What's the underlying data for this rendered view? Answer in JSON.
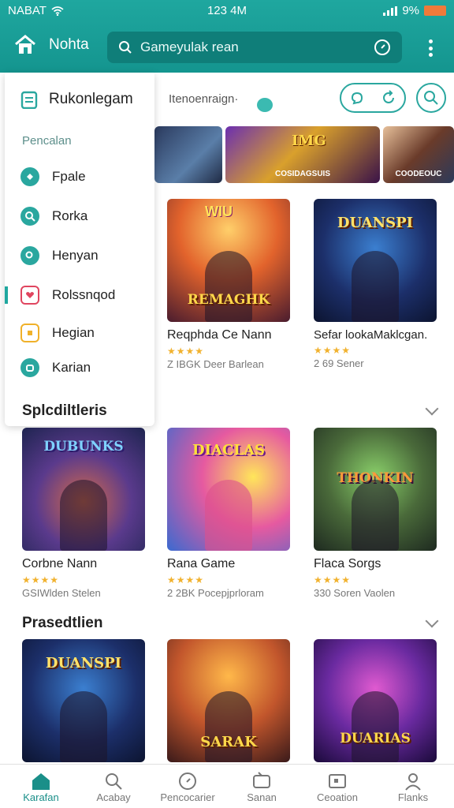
{
  "status": {
    "carrier": "NABAT",
    "time": "123 4M",
    "battery": "9%"
  },
  "appbar": {
    "home_label": "Nohta",
    "search_placeholder": "Gameyulak rean"
  },
  "subbar": {
    "label": "Itenoenraign·"
  },
  "banners": [
    {
      "caption": ""
    },
    {
      "caption": "COSIDAGSUIS",
      "logo": "IMG"
    },
    {
      "caption": ""
    },
    {
      "caption": "COODEOUC"
    }
  ],
  "featured": [
    {
      "title": "Reqphda Ce Nann",
      "stars": "★★★★",
      "meta": "Z IBGK Deer Barlean",
      "logo": "REMAGHK",
      "badge": "WIU"
    },
    {
      "title": "Sefar lookaMaklcgan.",
      "stars": "★★★★",
      "meta": "2 69 Sener",
      "logo": "DUANSPI"
    }
  ],
  "drawer": {
    "title": "Rukonlegam",
    "section": "Pencalan",
    "items": [
      {
        "label": "Fpale",
        "color": "#2aa79f"
      },
      {
        "label": "Rorka",
        "color": "#2aa79f"
      },
      {
        "label": "Henyan",
        "color": "#2aa79f"
      },
      {
        "label": "Rolssnqod",
        "color": "#e0455f",
        "active": true
      },
      {
        "label": "Hegian",
        "color": "#f0b12a"
      },
      {
        "label": "Karian",
        "color": "#2aa79f"
      }
    ]
  },
  "sections": [
    {
      "title": "Splcdiltleris",
      "cards": [
        {
          "title": "Corbne Nann",
          "stars": "★★★★",
          "meta": "GSIWlden Stelen",
          "logo": "DUBUNKS"
        },
        {
          "title": "Rana Game",
          "stars": "★★★★",
          "meta": "2 2BK Pocepjprloram",
          "logo": "DIACLAS"
        },
        {
          "title": "Flaca Sorgs",
          "stars": "★★★★",
          "meta": "330 Soren Vaolen",
          "logo": "THONKIN"
        }
      ]
    },
    {
      "title": "Prasedtlien",
      "cards": [
        {
          "logo": "DUANSPI"
        },
        {
          "logo": "SARAK"
        },
        {
          "logo": "DUARIAS"
        }
      ]
    }
  ],
  "bottomnav": [
    {
      "label": "Karafan",
      "icon": "home-icon",
      "active": true
    },
    {
      "label": "Acabay",
      "icon": "search-icon"
    },
    {
      "label": "Pencocarier",
      "icon": "compass-icon"
    },
    {
      "label": "Sanan",
      "icon": "controller-icon"
    },
    {
      "label": "Ceoation",
      "icon": "screen-icon"
    },
    {
      "label": "Flanks",
      "icon": "profile-icon"
    }
  ],
  "colors": {
    "accent": "#1fa79f",
    "star": "#f1b22f"
  }
}
